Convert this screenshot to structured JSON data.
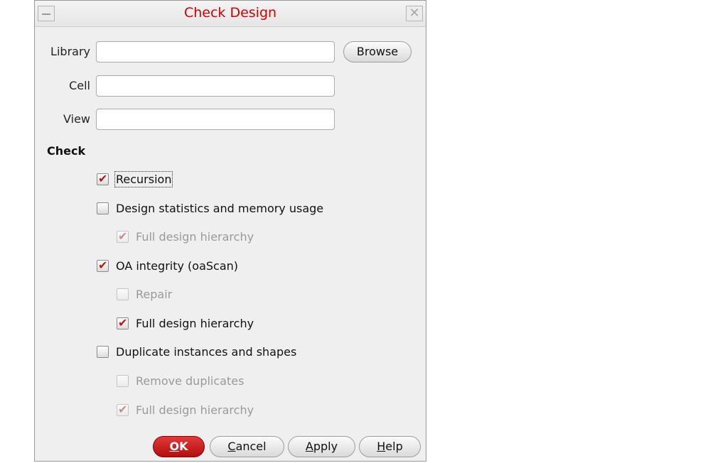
{
  "window": {
    "title": "Check Design"
  },
  "fields": {
    "library": {
      "label": "Library",
      "value": ""
    },
    "cell": {
      "label": "Cell",
      "value": ""
    },
    "view": {
      "label": "View",
      "value": ""
    },
    "browse_label": "Browse"
  },
  "check": {
    "section_label": "Check",
    "options": [
      {
        "label": "Recursion",
        "checked": true,
        "enabled": true
      },
      {
        "label": "Design statistics and memory usage",
        "checked": false,
        "enabled": true
      },
      {
        "label": "Full design hierarchy",
        "checked": true,
        "enabled": false
      },
      {
        "label": "OA integrity (oaScan)",
        "checked": true,
        "enabled": true
      },
      {
        "label": "Repair",
        "checked": false,
        "enabled": false
      },
      {
        "label": "Full design hierarchy",
        "checked": true,
        "enabled": true
      },
      {
        "label": "Duplicate instances and shapes",
        "checked": false,
        "enabled": true
      },
      {
        "label": "Remove duplicates",
        "checked": false,
        "enabled": false
      },
      {
        "label": "Full design hierarchy",
        "checked": true,
        "enabled": false
      }
    ]
  },
  "buttons": {
    "ok": {
      "mnemonic": "O",
      "rest": "K"
    },
    "cancel": {
      "mnemonic": "C",
      "rest": "ancel"
    },
    "apply": {
      "mnemonic": "A",
      "rest": "pply"
    },
    "help": {
      "mnemonic": "H",
      "rest": "elp"
    }
  },
  "colors": {
    "title": "#d40000",
    "check": "#c01616",
    "ok_button": "#c41a1a"
  }
}
